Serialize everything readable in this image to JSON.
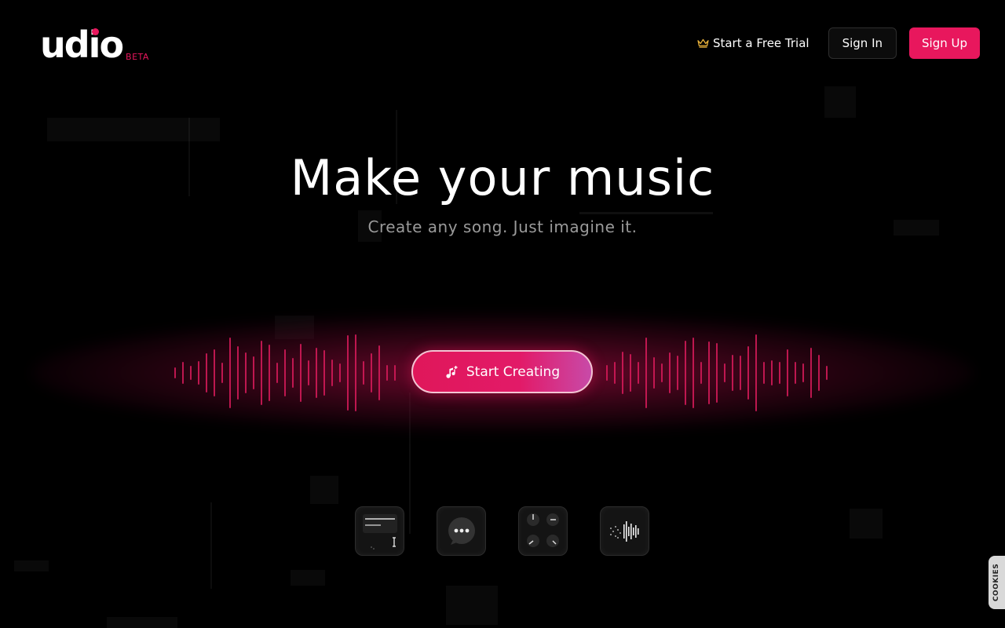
{
  "header": {
    "logo_text": "udio",
    "logo_badge": "BETA",
    "trial_label": "Start a Free Trial",
    "signin_label": "Sign In",
    "signup_label": "Sign Up"
  },
  "hero": {
    "title": "Make your music",
    "subtitle": "Create any song. Just imagine it.",
    "cta_label": "Start Creating"
  },
  "features": [
    {
      "icon": "lyrics-editor-icon"
    },
    {
      "icon": "chat-bubble-icon"
    },
    {
      "icon": "knobs-icon"
    },
    {
      "icon": "waveform-icon"
    }
  ],
  "cookies_label": "COOKIES",
  "colors": {
    "accent": "#e8175d",
    "background": "#000000",
    "subtitle": "#9a9a9a",
    "crown": "#e8b13a"
  }
}
